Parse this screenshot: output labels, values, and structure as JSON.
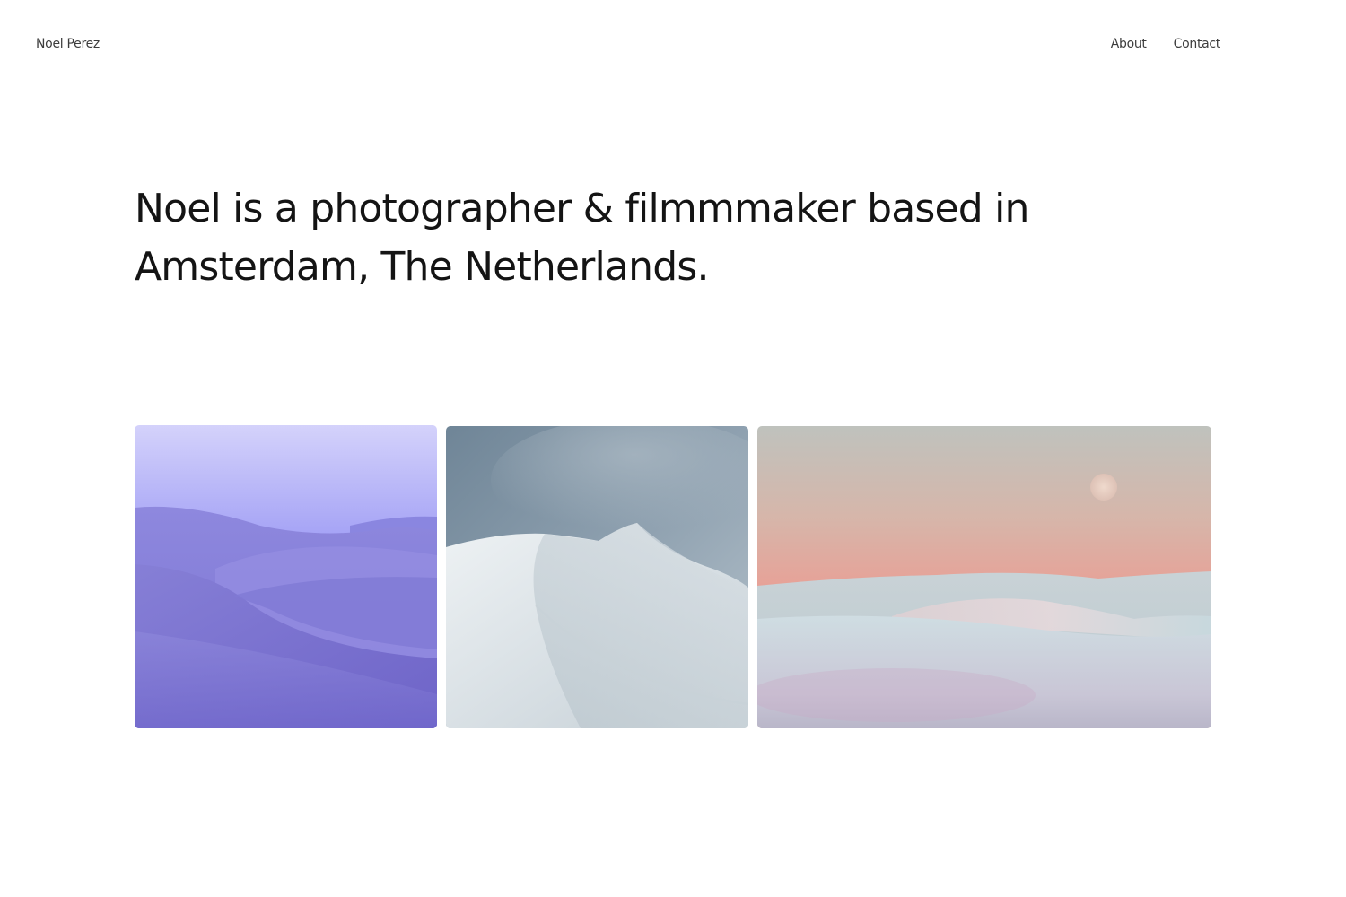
{
  "header": {
    "site_name": "Noel Perez",
    "nav": [
      {
        "label": "About"
      },
      {
        "label": "Contact"
      }
    ]
  },
  "hero": {
    "headline": "Noel is a photographer & filmmmaker based in Amsterdam, The Netherlands."
  },
  "gallery": {
    "photos": [
      {
        "subject": "violet desert dunes at dusk"
      },
      {
        "subject": "snow-covered ridge under a grey cloudy sky"
      },
      {
        "subject": "pale dunes beneath a pink sunset sky with the moon"
      }
    ]
  },
  "colors": {
    "text": "#141414",
    "nav_text": "#3c3c3c",
    "background": "#ffffff"
  }
}
